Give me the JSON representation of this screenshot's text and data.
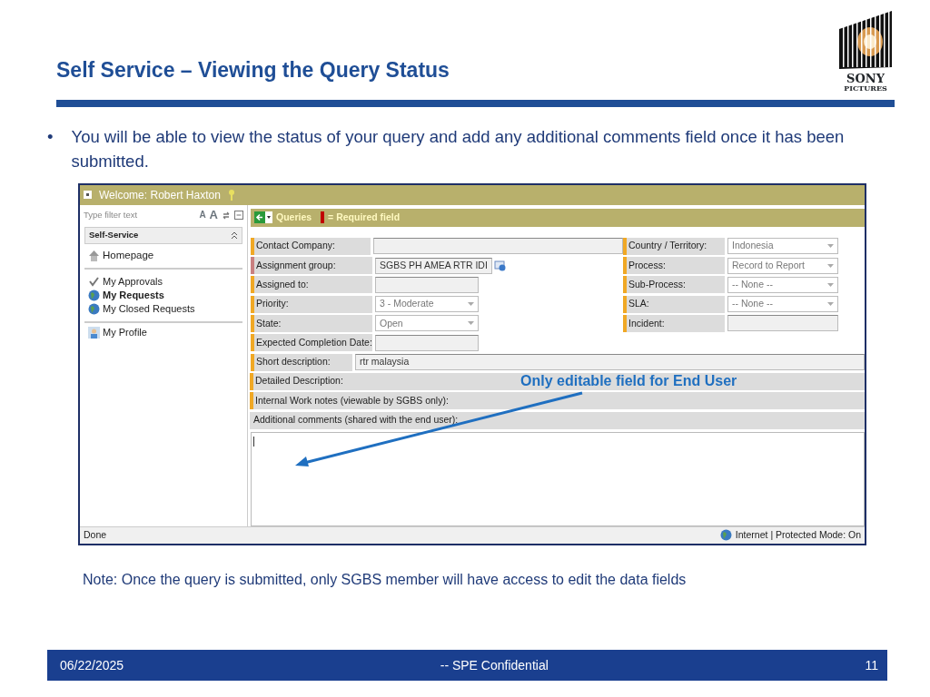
{
  "slide": {
    "title": "Self Service – Viewing the Query Status",
    "bullet_mark": "•",
    "bullet": "You will be able to view the status of your query  and add any additional comments field once it has been submitted.",
    "note": "Note:  Once the query is submitted, only SGBS member will have  access to edit the data fields",
    "footer": {
      "date": "06/22/2025",
      "center": "-- SPE Confidential",
      "page": "11"
    },
    "logo": {
      "line1": "SONY",
      "line2": "PICTURES"
    }
  },
  "app": {
    "welcome": "Welcome: Robert Haxton",
    "filter": {
      "placeholder": "Type filter text",
      "font_buttons": [
        "A",
        "A"
      ]
    },
    "sidebar": {
      "section": "Self-Service",
      "groups": [
        [
          {
            "label": "Homepage",
            "kind": "home",
            "selected": false
          }
        ],
        [
          {
            "label": "My Approvals",
            "kind": "check",
            "selected": false
          },
          {
            "label": "My Requests",
            "kind": "globe",
            "selected": true
          },
          {
            "label": "My Closed Requests",
            "kind": "globe",
            "selected": false
          }
        ],
        [
          {
            "label": "My Profile",
            "kind": "profile",
            "selected": false
          }
        ]
      ]
    },
    "header": {
      "title": "Queries",
      "legend": "= Required field"
    },
    "left_fields": [
      {
        "label": "Contact Company:",
        "kind": "widetext",
        "required": false
      },
      {
        "label": "Assignment group:",
        "value": "SGBS PH AMEA RTR IDI",
        "kind": "lookup",
        "required": true
      },
      {
        "label": "Assigned to:",
        "kind": "text",
        "required": false
      },
      {
        "label": "Priority:",
        "value": "3 - Moderate",
        "kind": "select",
        "required": false
      },
      {
        "label": "State:",
        "value": "Open",
        "kind": "select",
        "required": false
      },
      {
        "label": "Expected Completion Date:",
        "kind": "text",
        "required": false
      }
    ],
    "right_fields": [
      {
        "label": "Country / Territory:",
        "value": "Indonesia",
        "kind": "select"
      },
      {
        "label": "Process:",
        "value": "Record to Report",
        "kind": "select"
      },
      {
        "label": "Sub-Process:",
        "value": "-- None --",
        "kind": "select"
      },
      {
        "label": "SLA:",
        "value": "-- None --",
        "kind": "select"
      },
      {
        "label": "Incident:",
        "kind": "text"
      }
    ],
    "short_description": {
      "label": "Short description:",
      "value": "rtr malaysia"
    },
    "sections": [
      {
        "label": "Detailed Description:",
        "marker": true
      },
      {
        "label": "Internal Work notes (viewable by SGBS only):",
        "marker": true
      },
      {
        "label": "Additional comments (shared with the end user):",
        "marker": false
      }
    ],
    "status_left": "Done",
    "status_right": "Internet | Protected Mode: On"
  },
  "annotation": "Only editable field for End User"
}
